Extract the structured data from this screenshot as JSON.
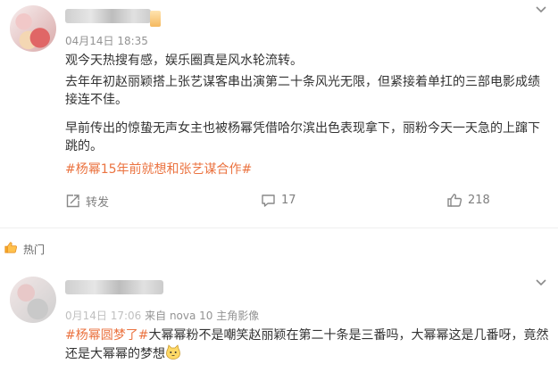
{
  "comments": [
    {
      "date": "04月14日 18:35",
      "paragraph1": "观今天热搜有感，娱乐圈真是风水轮流转。",
      "paragraph2": "去年年初赵丽颖搭上张艺谋客串出演第二十条风光无限，但紧接着单扛的三部电影成绩接连不佳。",
      "paragraph3": "早前传出的惊蛰无声女主也被杨幂凭借哈尔滨出色表现拿下，丽粉今天一天急的上蹿下跳的。",
      "hashtag": "#杨幂15年前就想和张艺谋合作#",
      "repost_label": "转发",
      "comment_count": "17",
      "like_count": "218"
    }
  ],
  "hot_section_label": "热门",
  "second_comment": {
    "date_partial": "0月14日 17:06",
    "source": "来自 nova 10 主角影像",
    "hashtag": "#杨幂圆梦了#",
    "text": "大幂幂粉不是嘲笑赵丽颖在第二十条是三番吗，大幂幂这是几番呀，竟然还是大幂幂的梦想"
  },
  "icons": {
    "more": "chevron-down-icon",
    "repost": "repost-icon",
    "comment": "comment-icon",
    "like": "thumbs-up-icon",
    "hot": "thumbs-up-icon",
    "emoji": "cat-emoji-icon"
  },
  "colors": {
    "hashtag": "#eb7340",
    "meta": "#939393",
    "text": "#333333"
  }
}
